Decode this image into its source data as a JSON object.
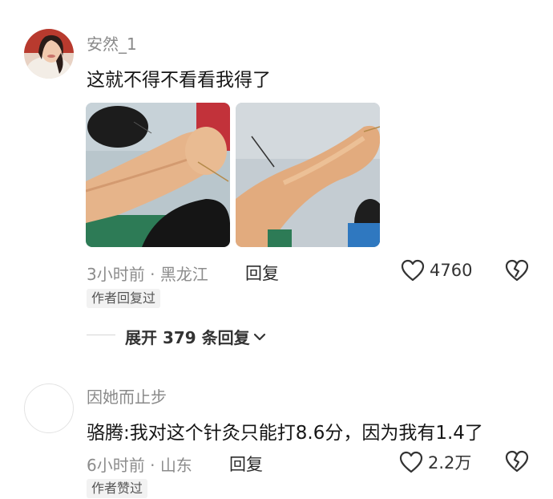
{
  "comments": [
    {
      "username": "安然_1",
      "text": "这就不得不看看我得了",
      "time": "3小时前",
      "location": "黑龙江",
      "reply_label": "回复",
      "badge": "作者回复过",
      "likes": "4760",
      "photos": [
        "arm-with-acupuncture-needle-photo-1",
        "arm-with-acupuncture-needle-photo-2"
      ]
    },
    {
      "username": "因她而止步",
      "text": "骆腾:我对这个针灸只能打8.6分，因为我有1.4了",
      "time": "6小时前",
      "location": "山东",
      "reply_label": "回复",
      "badge": "作者赞过",
      "likes": "2.2万"
    }
  ],
  "expand": {
    "label": "展开 379 条回复"
  },
  "separator": " · ",
  "colors": {
    "meta": "#8c8c8c",
    "username": "#8a8a8a",
    "badge_bg": "#f2f2f2"
  },
  "icons": [
    "heart-outline-icon",
    "broken-heart-icon",
    "chevron-down-icon"
  ]
}
